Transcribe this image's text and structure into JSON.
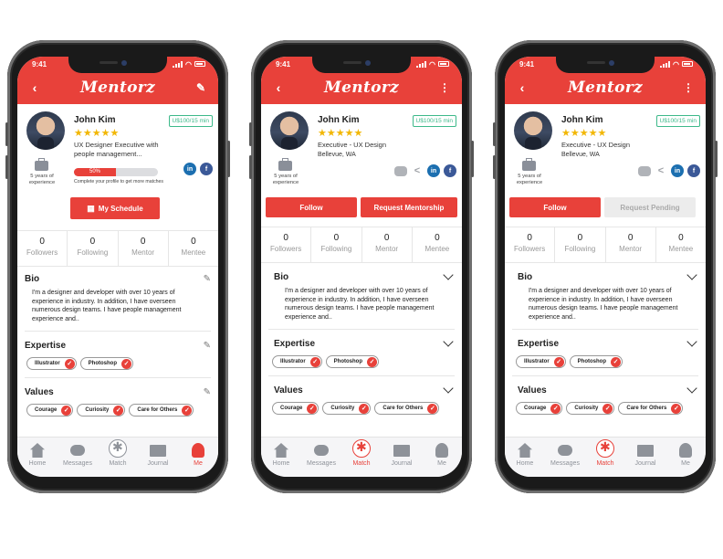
{
  "brand": "Mentorz",
  "time": "9:41",
  "colors": {
    "accent": "#e8413a",
    "star": "#f2b705",
    "rate_green": "#3db98a"
  },
  "stat_labels": [
    "Followers",
    "Following",
    "Mentor",
    "Mentee"
  ],
  "tabs": [
    "Home",
    "Messages",
    "Match",
    "Journal",
    "Me"
  ],
  "phone1": {
    "name": "John Kim",
    "stars": "★★★★★",
    "rate": "U$100/15 min",
    "title": "UX Designer Executive with people management...",
    "experience": "5 years of experience",
    "progress_label": "50%",
    "progress_value": 50,
    "progress_note": "Complete your profile to get more matches",
    "social_in": "in",
    "social_fb": "f",
    "schedule_button": "My Schedule",
    "stats": [
      "0",
      "0",
      "0",
      "0"
    ],
    "bio_title": "Bio",
    "bio": "I'm a designer and developer with over 10 years of experience in industry. In addition, I have overseen numerous design teams. I have people management experience and..",
    "expertise_title": "Expertise",
    "expertise": [
      "Illustrator",
      "Photoshop"
    ],
    "values_title": "Values",
    "values": [
      "Courage",
      "Curiosity",
      "Care for Others"
    ],
    "active_tab": "Me"
  },
  "phone2": {
    "name": "John Kim",
    "stars": "★★★★★",
    "rate": "U$100/15 min",
    "title": "Executive - UX Design",
    "location": "Bellevue, WA",
    "experience": "5 years of experience",
    "social_in": "in",
    "social_fb": "f",
    "follow_button": "Follow",
    "mentorship_button": "Request Mentorship",
    "stats": [
      "0",
      "0",
      "0",
      "0"
    ],
    "bio_title": "Bio",
    "bio": "I'm a designer and developer with over 10 years of experience in industry. In addition, I have overseen numerous design teams. I have people management experience and..",
    "expertise_title": "Expertise",
    "expertise": [
      "Illustrator",
      "Photoshop"
    ],
    "values_title": "Values",
    "values": [
      "Courage",
      "Curiosity",
      "Care for Others"
    ],
    "active_tab": "Match"
  },
  "phone3": {
    "name": "John Kim",
    "stars": "★★★★★",
    "rate": "U$100/15 min",
    "title": "Executive - UX Design",
    "location": "Bellevue, WA",
    "experience": "5 years of experience",
    "social_in": "in",
    "social_fb": "f",
    "follow_button": "Follow",
    "pending_button": "Request Pending",
    "stats": [
      "0",
      "0",
      "0",
      "0"
    ],
    "bio_title": "Bio",
    "bio": "I'm a designer and developer with over 10 years of experience in industry. In addition, I have overseen numerous design teams. I have people management experience and..",
    "expertise_title": "Expertise",
    "expertise": [
      "Illustrator",
      "Photoshop"
    ],
    "values_title": "Values",
    "values": [
      "Courage",
      "Curiosity",
      "Care for Others"
    ],
    "active_tab": "Match"
  }
}
